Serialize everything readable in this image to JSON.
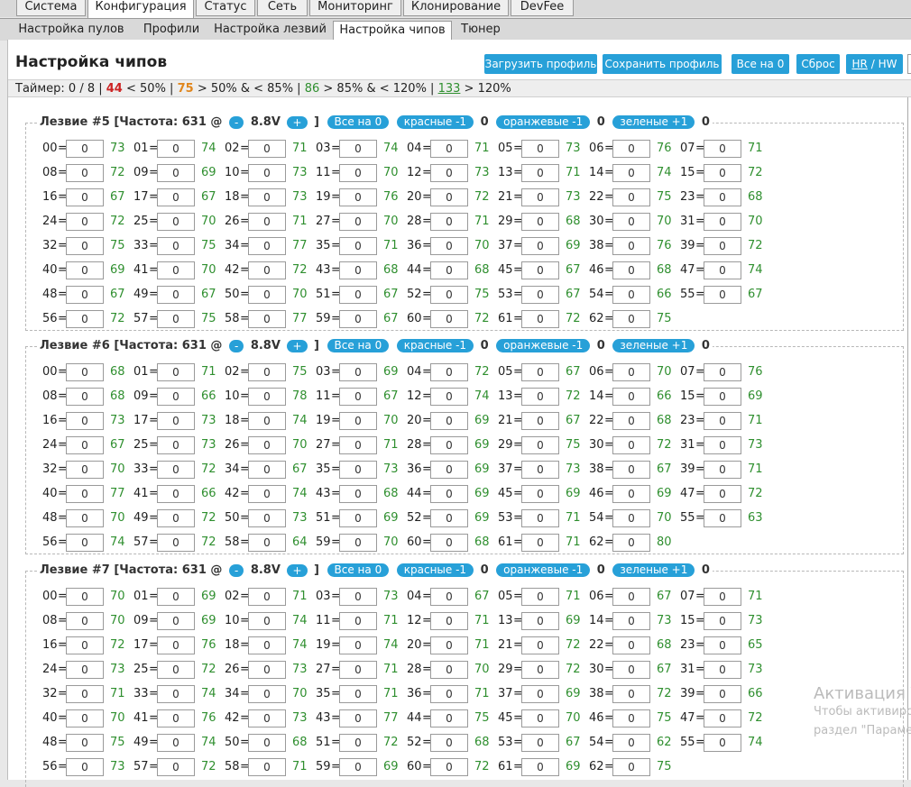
{
  "top_tabs": [
    {
      "label": "Система",
      "active": false
    },
    {
      "label": "Конфигурация",
      "active": true
    },
    {
      "label": "Статус",
      "active": false
    },
    {
      "label": "Сеть",
      "active": false
    },
    {
      "label": "Мониторинг",
      "active": false
    },
    {
      "label": "Клонирование",
      "active": false
    },
    {
      "label": "DevFee",
      "active": false
    }
  ],
  "sub_tabs": [
    {
      "label": "Настройка пулов",
      "active": false
    },
    {
      "label": "Профили",
      "active": false
    },
    {
      "label": "Настройка лезвий",
      "active": false
    },
    {
      "label": "Настройка чипов",
      "active": true
    },
    {
      "label": "Тюнер",
      "active": false
    }
  ],
  "page": {
    "title": "Настройка чипов",
    "buttons": {
      "load_profile": "Загрузить профиль",
      "save_profile": "Сохранить профиль",
      "all_zero": "Все на 0",
      "reset": "Сброс",
      "hr": "HR",
      "sep": "/",
      "hw": "HW"
    }
  },
  "timer": {
    "label": "Таймер: 0 / 8 |",
    "red_count": "44",
    "red_text": "< 50% |",
    "orange_count": "75",
    "orange_text": "> 50% & < 85% |",
    "green_count": "86",
    "green_text": "> 85% & < 120% |",
    "over_count": "133",
    "over_text": "> 120%"
  },
  "colors": {
    "accent": "#27a0d8",
    "green": "#2f8f2f",
    "red": "#cc2222",
    "orange": "#e0861d"
  },
  "blade_controls": {
    "freq_prefix": "[Частота: 631 @",
    "minus": "-",
    "voltage": "8.8V",
    "plus": "+",
    "freq_suffix": "]",
    "all_zero": "Все на 0",
    "red": "красные -1",
    "orange": "оранжевые -1",
    "green": "зеленые +1"
  },
  "blades": [
    {
      "title": "Лезвие #5",
      "red_count": "0",
      "orange_count": "0",
      "green_count": "0",
      "chips": [
        {
          "id": "00",
          "value": "0",
          "hw": "73"
        },
        {
          "id": "01",
          "value": "0",
          "hw": "74"
        },
        {
          "id": "02",
          "value": "0",
          "hw": "71"
        },
        {
          "id": "03",
          "value": "0",
          "hw": "74"
        },
        {
          "id": "04",
          "value": "0",
          "hw": "71"
        },
        {
          "id": "05",
          "value": "0",
          "hw": "73"
        },
        {
          "id": "06",
          "value": "0",
          "hw": "76"
        },
        {
          "id": "07",
          "value": "0",
          "hw": "71"
        },
        {
          "id": "08",
          "value": "0",
          "hw": "72"
        },
        {
          "id": "09",
          "value": "0",
          "hw": "69"
        },
        {
          "id": "10",
          "value": "0",
          "hw": "73"
        },
        {
          "id": "11",
          "value": "0",
          "hw": "70"
        },
        {
          "id": "12",
          "value": "0",
          "hw": "73"
        },
        {
          "id": "13",
          "value": "0",
          "hw": "71"
        },
        {
          "id": "14",
          "value": "0",
          "hw": "74"
        },
        {
          "id": "15",
          "value": "0",
          "hw": "72"
        },
        {
          "id": "16",
          "value": "0",
          "hw": "67"
        },
        {
          "id": "17",
          "value": "0",
          "hw": "67"
        },
        {
          "id": "18",
          "value": "0",
          "hw": "73"
        },
        {
          "id": "19",
          "value": "0",
          "hw": "76"
        },
        {
          "id": "20",
          "value": "0",
          "hw": "72"
        },
        {
          "id": "21",
          "value": "0",
          "hw": "73"
        },
        {
          "id": "22",
          "value": "0",
          "hw": "75"
        },
        {
          "id": "23",
          "value": "0",
          "hw": "68"
        },
        {
          "id": "24",
          "value": "0",
          "hw": "72"
        },
        {
          "id": "25",
          "value": "0",
          "hw": "70"
        },
        {
          "id": "26",
          "value": "0",
          "hw": "71"
        },
        {
          "id": "27",
          "value": "0",
          "hw": "70"
        },
        {
          "id": "28",
          "value": "0",
          "hw": "71"
        },
        {
          "id": "29",
          "value": "0",
          "hw": "68"
        },
        {
          "id": "30",
          "value": "0",
          "hw": "70"
        },
        {
          "id": "31",
          "value": "0",
          "hw": "70"
        },
        {
          "id": "32",
          "value": "0",
          "hw": "75"
        },
        {
          "id": "33",
          "value": "0",
          "hw": "75"
        },
        {
          "id": "34",
          "value": "0",
          "hw": "77"
        },
        {
          "id": "35",
          "value": "0",
          "hw": "71"
        },
        {
          "id": "36",
          "value": "0",
          "hw": "70"
        },
        {
          "id": "37",
          "value": "0",
          "hw": "69"
        },
        {
          "id": "38",
          "value": "0",
          "hw": "76"
        },
        {
          "id": "39",
          "value": "0",
          "hw": "72"
        },
        {
          "id": "40",
          "value": "0",
          "hw": "69"
        },
        {
          "id": "41",
          "value": "0",
          "hw": "70"
        },
        {
          "id": "42",
          "value": "0",
          "hw": "72"
        },
        {
          "id": "43",
          "value": "0",
          "hw": "68"
        },
        {
          "id": "44",
          "value": "0",
          "hw": "68"
        },
        {
          "id": "45",
          "value": "0",
          "hw": "67"
        },
        {
          "id": "46",
          "value": "0",
          "hw": "68"
        },
        {
          "id": "47",
          "value": "0",
          "hw": "74"
        },
        {
          "id": "48",
          "value": "0",
          "hw": "67"
        },
        {
          "id": "49",
          "value": "0",
          "hw": "67"
        },
        {
          "id": "50",
          "value": "0",
          "hw": "70"
        },
        {
          "id": "51",
          "value": "0",
          "hw": "67"
        },
        {
          "id": "52",
          "value": "0",
          "hw": "75"
        },
        {
          "id": "53",
          "value": "0",
          "hw": "67"
        },
        {
          "id": "54",
          "value": "0",
          "hw": "66"
        },
        {
          "id": "55",
          "value": "0",
          "hw": "67"
        },
        {
          "id": "56",
          "value": "0",
          "hw": "72"
        },
        {
          "id": "57",
          "value": "0",
          "hw": "75"
        },
        {
          "id": "58",
          "value": "0",
          "hw": "77"
        },
        {
          "id": "59",
          "value": "0",
          "hw": "67"
        },
        {
          "id": "60",
          "value": "0",
          "hw": "72"
        },
        {
          "id": "61",
          "value": "0",
          "hw": "72"
        },
        {
          "id": "62",
          "value": "0",
          "hw": "75"
        }
      ]
    },
    {
      "title": "Лезвие #6",
      "red_count": "0",
      "orange_count": "0",
      "green_count": "0",
      "chips": [
        {
          "id": "00",
          "value": "0",
          "hw": "68"
        },
        {
          "id": "01",
          "value": "0",
          "hw": "71"
        },
        {
          "id": "02",
          "value": "0",
          "hw": "75"
        },
        {
          "id": "03",
          "value": "0",
          "hw": "69"
        },
        {
          "id": "04",
          "value": "0",
          "hw": "72"
        },
        {
          "id": "05",
          "value": "0",
          "hw": "67"
        },
        {
          "id": "06",
          "value": "0",
          "hw": "70"
        },
        {
          "id": "07",
          "value": "0",
          "hw": "76"
        },
        {
          "id": "08",
          "value": "0",
          "hw": "68"
        },
        {
          "id": "09",
          "value": "0",
          "hw": "66"
        },
        {
          "id": "10",
          "value": "0",
          "hw": "78"
        },
        {
          "id": "11",
          "value": "0",
          "hw": "67"
        },
        {
          "id": "12",
          "value": "0",
          "hw": "74"
        },
        {
          "id": "13",
          "value": "0",
          "hw": "72"
        },
        {
          "id": "14",
          "value": "0",
          "hw": "66"
        },
        {
          "id": "15",
          "value": "0",
          "hw": "69"
        },
        {
          "id": "16",
          "value": "0",
          "hw": "73"
        },
        {
          "id": "17",
          "value": "0",
          "hw": "73"
        },
        {
          "id": "18",
          "value": "0",
          "hw": "74"
        },
        {
          "id": "19",
          "value": "0",
          "hw": "70"
        },
        {
          "id": "20",
          "value": "0",
          "hw": "69"
        },
        {
          "id": "21",
          "value": "0",
          "hw": "67"
        },
        {
          "id": "22",
          "value": "0",
          "hw": "68"
        },
        {
          "id": "23",
          "value": "0",
          "hw": "71"
        },
        {
          "id": "24",
          "value": "0",
          "hw": "67"
        },
        {
          "id": "25",
          "value": "0",
          "hw": "73"
        },
        {
          "id": "26",
          "value": "0",
          "hw": "70"
        },
        {
          "id": "27",
          "value": "0",
          "hw": "71"
        },
        {
          "id": "28",
          "value": "0",
          "hw": "69"
        },
        {
          "id": "29",
          "value": "0",
          "hw": "75"
        },
        {
          "id": "30",
          "value": "0",
          "hw": "72"
        },
        {
          "id": "31",
          "value": "0",
          "hw": "73"
        },
        {
          "id": "32",
          "value": "0",
          "hw": "70"
        },
        {
          "id": "33",
          "value": "0",
          "hw": "72"
        },
        {
          "id": "34",
          "value": "0",
          "hw": "67"
        },
        {
          "id": "35",
          "value": "0",
          "hw": "73"
        },
        {
          "id": "36",
          "value": "0",
          "hw": "69"
        },
        {
          "id": "37",
          "value": "0",
          "hw": "73"
        },
        {
          "id": "38",
          "value": "0",
          "hw": "67"
        },
        {
          "id": "39",
          "value": "0",
          "hw": "71"
        },
        {
          "id": "40",
          "value": "0",
          "hw": "77"
        },
        {
          "id": "41",
          "value": "0",
          "hw": "66"
        },
        {
          "id": "42",
          "value": "0",
          "hw": "74"
        },
        {
          "id": "43",
          "value": "0",
          "hw": "68"
        },
        {
          "id": "44",
          "value": "0",
          "hw": "69"
        },
        {
          "id": "45",
          "value": "0",
          "hw": "69"
        },
        {
          "id": "46",
          "value": "0",
          "hw": "69"
        },
        {
          "id": "47",
          "value": "0",
          "hw": "72"
        },
        {
          "id": "48",
          "value": "0",
          "hw": "70"
        },
        {
          "id": "49",
          "value": "0",
          "hw": "72"
        },
        {
          "id": "50",
          "value": "0",
          "hw": "73"
        },
        {
          "id": "51",
          "value": "0",
          "hw": "69"
        },
        {
          "id": "52",
          "value": "0",
          "hw": "69"
        },
        {
          "id": "53",
          "value": "0",
          "hw": "71"
        },
        {
          "id": "54",
          "value": "0",
          "hw": "70"
        },
        {
          "id": "55",
          "value": "0",
          "hw": "63"
        },
        {
          "id": "56",
          "value": "0",
          "hw": "74"
        },
        {
          "id": "57",
          "value": "0",
          "hw": "72"
        },
        {
          "id": "58",
          "value": "0",
          "hw": "64"
        },
        {
          "id": "59",
          "value": "0",
          "hw": "70"
        },
        {
          "id": "60",
          "value": "0",
          "hw": "68"
        },
        {
          "id": "61",
          "value": "0",
          "hw": "71"
        },
        {
          "id": "62",
          "value": "0",
          "hw": "80"
        }
      ]
    },
    {
      "title": "Лезвие #7",
      "red_count": "0",
      "orange_count": "0",
      "green_count": "0",
      "chips": [
        {
          "id": "00",
          "value": "0",
          "hw": "70"
        },
        {
          "id": "01",
          "value": "0",
          "hw": "69"
        },
        {
          "id": "02",
          "value": "0",
          "hw": "71"
        },
        {
          "id": "03",
          "value": "0",
          "hw": "73"
        },
        {
          "id": "04",
          "value": "0",
          "hw": "67"
        },
        {
          "id": "05",
          "value": "0",
          "hw": "71"
        },
        {
          "id": "06",
          "value": "0",
          "hw": "67"
        },
        {
          "id": "07",
          "value": "0",
          "hw": "71"
        },
        {
          "id": "08",
          "value": "0",
          "hw": "70"
        },
        {
          "id": "09",
          "value": "0",
          "hw": "69"
        },
        {
          "id": "10",
          "value": "0",
          "hw": "74"
        },
        {
          "id": "11",
          "value": "0",
          "hw": "71"
        },
        {
          "id": "12",
          "value": "0",
          "hw": "71"
        },
        {
          "id": "13",
          "value": "0",
          "hw": "69"
        },
        {
          "id": "14",
          "value": "0",
          "hw": "73"
        },
        {
          "id": "15",
          "value": "0",
          "hw": "73"
        },
        {
          "id": "16",
          "value": "0",
          "hw": "72"
        },
        {
          "id": "17",
          "value": "0",
          "hw": "76"
        },
        {
          "id": "18",
          "value": "0",
          "hw": "74"
        },
        {
          "id": "19",
          "value": "0",
          "hw": "74"
        },
        {
          "id": "20",
          "value": "0",
          "hw": "71"
        },
        {
          "id": "21",
          "value": "0",
          "hw": "72"
        },
        {
          "id": "22",
          "value": "0",
          "hw": "68"
        },
        {
          "id": "23",
          "value": "0",
          "hw": "65"
        },
        {
          "id": "24",
          "value": "0",
          "hw": "73"
        },
        {
          "id": "25",
          "value": "0",
          "hw": "72"
        },
        {
          "id": "26",
          "value": "0",
          "hw": "73"
        },
        {
          "id": "27",
          "value": "0",
          "hw": "71"
        },
        {
          "id": "28",
          "value": "0",
          "hw": "70"
        },
        {
          "id": "29",
          "value": "0",
          "hw": "72"
        },
        {
          "id": "30",
          "value": "0",
          "hw": "67"
        },
        {
          "id": "31",
          "value": "0",
          "hw": "73"
        },
        {
          "id": "32",
          "value": "0",
          "hw": "71"
        },
        {
          "id": "33",
          "value": "0",
          "hw": "74"
        },
        {
          "id": "34",
          "value": "0",
          "hw": "70"
        },
        {
          "id": "35",
          "value": "0",
          "hw": "71"
        },
        {
          "id": "36",
          "value": "0",
          "hw": "71"
        },
        {
          "id": "37",
          "value": "0",
          "hw": "69"
        },
        {
          "id": "38",
          "value": "0",
          "hw": "72"
        },
        {
          "id": "39",
          "value": "0",
          "hw": "66"
        },
        {
          "id": "40",
          "value": "0",
          "hw": "70"
        },
        {
          "id": "41",
          "value": "0",
          "hw": "76"
        },
        {
          "id": "42",
          "value": "0",
          "hw": "73"
        },
        {
          "id": "43",
          "value": "0",
          "hw": "77"
        },
        {
          "id": "44",
          "value": "0",
          "hw": "75"
        },
        {
          "id": "45",
          "value": "0",
          "hw": "70"
        },
        {
          "id": "46",
          "value": "0",
          "hw": "75"
        },
        {
          "id": "47",
          "value": "0",
          "hw": "72"
        },
        {
          "id": "48",
          "value": "0",
          "hw": "75"
        },
        {
          "id": "49",
          "value": "0",
          "hw": "74"
        },
        {
          "id": "50",
          "value": "0",
          "hw": "68"
        },
        {
          "id": "51",
          "value": "0",
          "hw": "72"
        },
        {
          "id": "52",
          "value": "0",
          "hw": "68"
        },
        {
          "id": "53",
          "value": "0",
          "hw": "67"
        },
        {
          "id": "54",
          "value": "0",
          "hw": "62"
        },
        {
          "id": "55",
          "value": "0",
          "hw": "74"
        },
        {
          "id": "56",
          "value": "0",
          "hw": "73"
        },
        {
          "id": "57",
          "value": "0",
          "hw": "72"
        },
        {
          "id": "58",
          "value": "0",
          "hw": "71"
        },
        {
          "id": "59",
          "value": "0",
          "hw": "69"
        },
        {
          "id": "60",
          "value": "0",
          "hw": "72"
        },
        {
          "id": "61",
          "value": "0",
          "hw": "69"
        },
        {
          "id": "62",
          "value": "0",
          "hw": "75"
        }
      ]
    }
  ],
  "watermark": {
    "line1": "Активация V",
    "line2": "Чтобы активиро",
    "line3": "раздел \"Параме"
  }
}
